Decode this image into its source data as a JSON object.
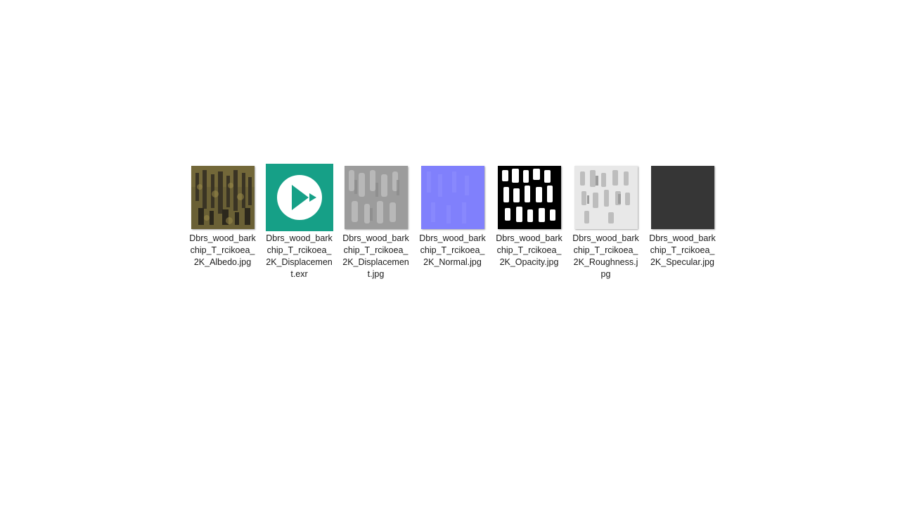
{
  "files": [
    {
      "name": "Dbrs_wood_barkchip_T_rcikoea_2K_Albedo.jpg",
      "icon": "albedo-thumbnail",
      "color": "#5d5430"
    },
    {
      "name": "Dbrs_wood_barkchip_T_rcikoea_2K_Displacement.exr",
      "icon": "media-player-icon",
      "color": "#16a087"
    },
    {
      "name": "Dbrs_wood_barkchip_T_rcikoea_2K_Displacement.jpg",
      "icon": "displacement-thumbnail",
      "color": "#9a9a9a"
    },
    {
      "name": "Dbrs_wood_barkchip_T_rcikoea_2K_Normal.jpg",
      "icon": "normal-thumbnail",
      "color": "#8080ff"
    },
    {
      "name": "Dbrs_wood_barkchip_T_rcikoea_2K_Opacity.jpg",
      "icon": "opacity-thumbnail",
      "color": "#000000"
    },
    {
      "name": "Dbrs_wood_barkchip_T_rcikoea_2K_Roughness.jpg",
      "icon": "roughness-thumbnail",
      "color": "#e6e6e6"
    },
    {
      "name": "Dbrs_wood_barkchip_T_rcikoea_2K_Specular.jpg",
      "icon": "specular-thumbnail",
      "color": "#353535"
    }
  ]
}
